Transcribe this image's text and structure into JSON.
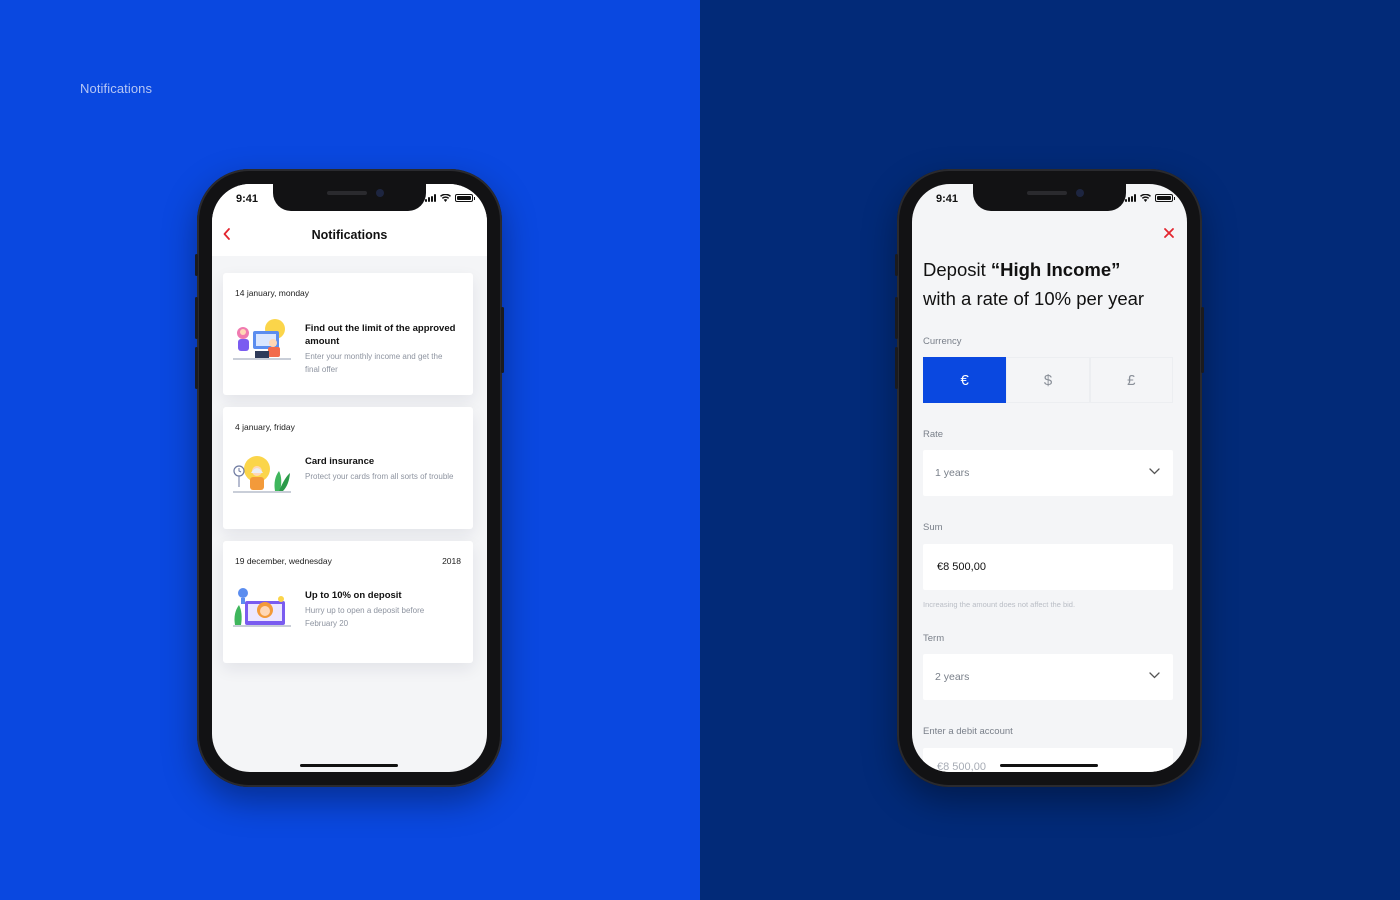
{
  "colors": {
    "left_bg": "#0a48e0",
    "right_bg": "#022a78",
    "accent": "#0a48e0",
    "danger": "#e3262f"
  },
  "section_label": "Notifications",
  "status": {
    "time": "9:41"
  },
  "notifications_screen": {
    "title": "Notifications",
    "cards": [
      {
        "date": "14 january, monday",
        "year": "",
        "title": "Find out the limit of the approved amount",
        "desc": "Enter your monthly income and get the final offer",
        "icon": "income-illustration-icon"
      },
      {
        "date": "4 january, friday",
        "year": "",
        "title": "Card insurance",
        "desc": "Protect your cards from all sorts of trouble",
        "icon": "insurance-illustration-icon"
      },
      {
        "date": "19 december, wednesday",
        "year": "2018",
        "title": "Up to 10% on deposit",
        "desc": "Hurry up to open a deposit before February 20",
        "icon": "deposit-illustration-icon"
      }
    ]
  },
  "deposit_screen": {
    "title_prefix": "Deposit ",
    "title_bold": "“High Income”",
    "subtitle": "with a rate of 10% per year",
    "currency_label": "Currency",
    "currencies": [
      "€",
      "$",
      "£"
    ],
    "selected_currency": "€",
    "rate_label": "Rate",
    "rate_value": "1 years",
    "sum_label": "Sum",
    "sum_value": "€8 500,00",
    "sum_hint": "Increasing the amount does not affect the bid.",
    "term_label": "Term",
    "term_value": "2 years",
    "debit_label": "Enter a debit account",
    "debit_value": "€8 500,00"
  }
}
